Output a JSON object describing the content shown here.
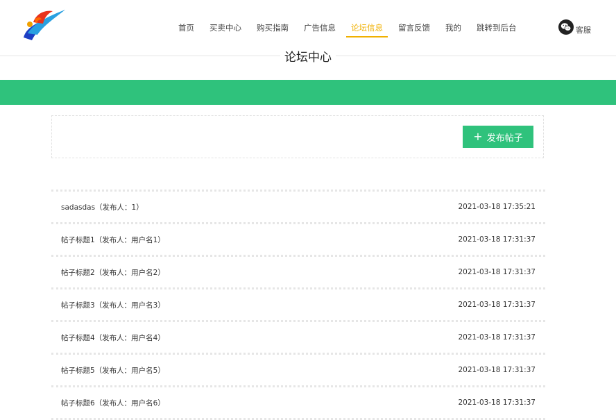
{
  "nav": {
    "items": [
      {
        "label": "首页"
      },
      {
        "label": "买卖中心"
      },
      {
        "label": "购买指南"
      },
      {
        "label": "广告信息"
      },
      {
        "label": "论坛信息"
      },
      {
        "label": "留言反馈"
      },
      {
        "label": "我的"
      },
      {
        "label": "跳转到后台"
      }
    ],
    "active_index": 4,
    "kefu_label": "客服"
  },
  "section_title": "论坛中心",
  "publish_button_label": "发布帖子",
  "posts": [
    {
      "title": "sadasdas（发布人：1）",
      "time": "2021-03-18 17:35:21"
    },
    {
      "title": "帖子标题1（发布人：用户名1）",
      "time": "2021-03-18 17:31:37"
    },
    {
      "title": "帖子标题2（发布人：用户名2）",
      "time": "2021-03-18 17:31:37"
    },
    {
      "title": "帖子标题3（发布人：用户名3）",
      "time": "2021-03-18 17:31:37"
    },
    {
      "title": "帖子标题4（发布人：用户名4）",
      "time": "2021-03-18 17:31:37"
    },
    {
      "title": "帖子标题5（发布人：用户名5）",
      "time": "2021-03-18 17:31:37"
    },
    {
      "title": "帖子标题6（发布人：用户名6）",
      "time": "2021-03-18 17:31:37"
    }
  ],
  "colors": {
    "accent_green": "#2fc27c",
    "active_nav": "#f0b000"
  },
  "icons": {
    "logo": "flame-swoosh-logo",
    "kefu": "wechat-icon",
    "publish": "plus-icon"
  }
}
